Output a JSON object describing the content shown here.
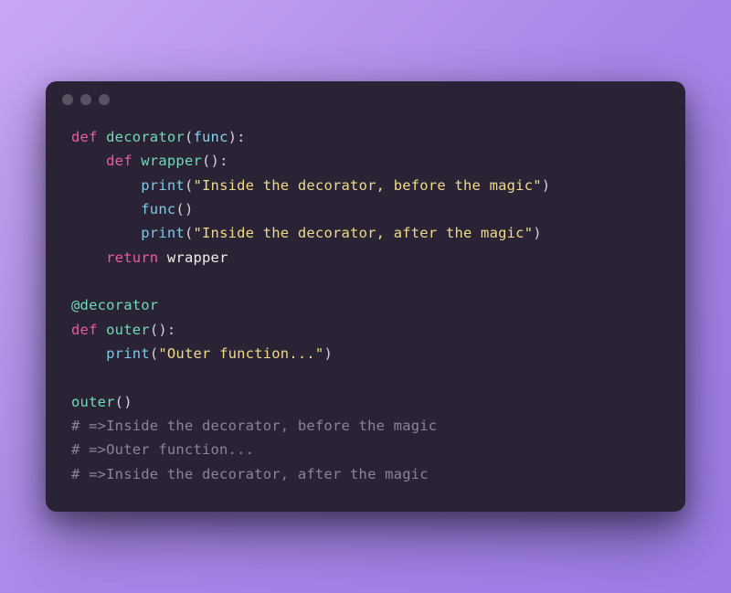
{
  "code": {
    "line1": {
      "def": "def",
      "fname": " decorator",
      "lparen": "(",
      "param": "func",
      "rparen_colon": "):"
    },
    "line2": {
      "indent": "    ",
      "def": "def",
      "fname": " wrapper",
      "parens_colon": "():"
    },
    "line3": {
      "indent": "        ",
      "print": "print",
      "lparen": "(",
      "str": "\"Inside the decorator, before the magic\"",
      "rparen": ")"
    },
    "line4": {
      "indent": "        ",
      "func": "func",
      "parens": "()"
    },
    "line5": {
      "indent": "        ",
      "print": "print",
      "lparen": "(",
      "str": "\"Inside the decorator, after the magic\"",
      "rparen": ")"
    },
    "line6": {
      "indent": "    ",
      "return": "return",
      "space": " ",
      "ident": "wrapper"
    },
    "blank1": "",
    "line7": {
      "decorator": "@decorator"
    },
    "line8": {
      "def": "def",
      "fname": " outer",
      "parens_colon": "():"
    },
    "line9": {
      "indent": "    ",
      "print": "print",
      "lparen": "(",
      "str": "\"Outer function...\"",
      "rparen": ")"
    },
    "blank2": "",
    "line10": {
      "call": "outer",
      "parens": "()"
    },
    "line11": {
      "comment": "# =>Inside the decorator, before the magic"
    },
    "line12": {
      "comment": "# =>Outer function..."
    },
    "line13": {
      "comment": "# =>Inside the decorator, after the magic"
    }
  }
}
